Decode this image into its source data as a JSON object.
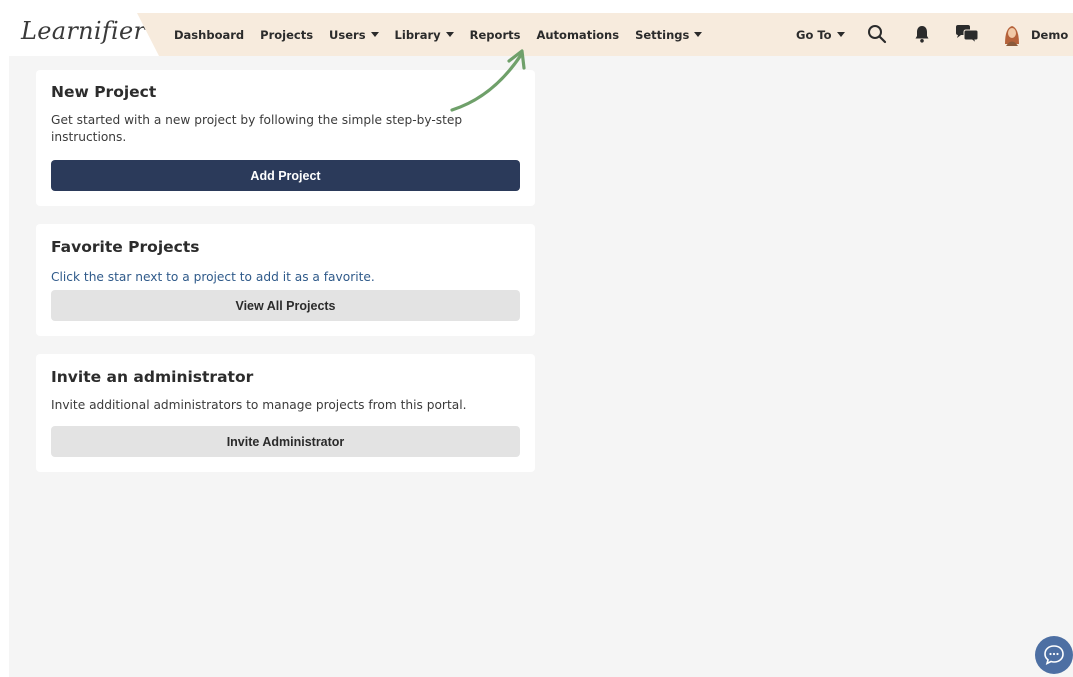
{
  "app": {
    "logo_text": "Learnifier"
  },
  "nav": {
    "items": [
      {
        "label": "Dashboard",
        "dropdown": false
      },
      {
        "label": "Projects",
        "dropdown": false
      },
      {
        "label": "Users",
        "dropdown": true
      },
      {
        "label": "Library",
        "dropdown": true
      },
      {
        "label": "Reports",
        "dropdown": false
      },
      {
        "label": "Automations",
        "dropdown": false
      },
      {
        "label": "Settings",
        "dropdown": true
      }
    ],
    "goto_label": "Go To",
    "user_label": "Demo"
  },
  "icons": {
    "search": "search-icon",
    "notifications": "bell-icon",
    "messages": "chat-bubbles-icon",
    "chat_widget": "chat-widget-icon"
  },
  "cards": {
    "new_project": {
      "title": "New Project",
      "text": "Get started with a new project by following the simple step-by-step instructions.",
      "button": "Add Project"
    },
    "favorite_projects": {
      "title": "Favorite Projects",
      "text": "Click the star next to a project to add it as a favorite.",
      "button": "View All Projects"
    },
    "invite_admin": {
      "title": "Invite an administrator",
      "text": "Invite additional administrators to manage projects from this portal.",
      "button": "Invite Administrator"
    }
  },
  "colors": {
    "topbar": "#f7ebdd",
    "primary_button": "#2b3a5a",
    "secondary_button": "#e3e3e3",
    "link_text": "#2f5a8a",
    "annotation_arrow": "#6fa06a",
    "chat_widget": "#4d6fa3"
  }
}
